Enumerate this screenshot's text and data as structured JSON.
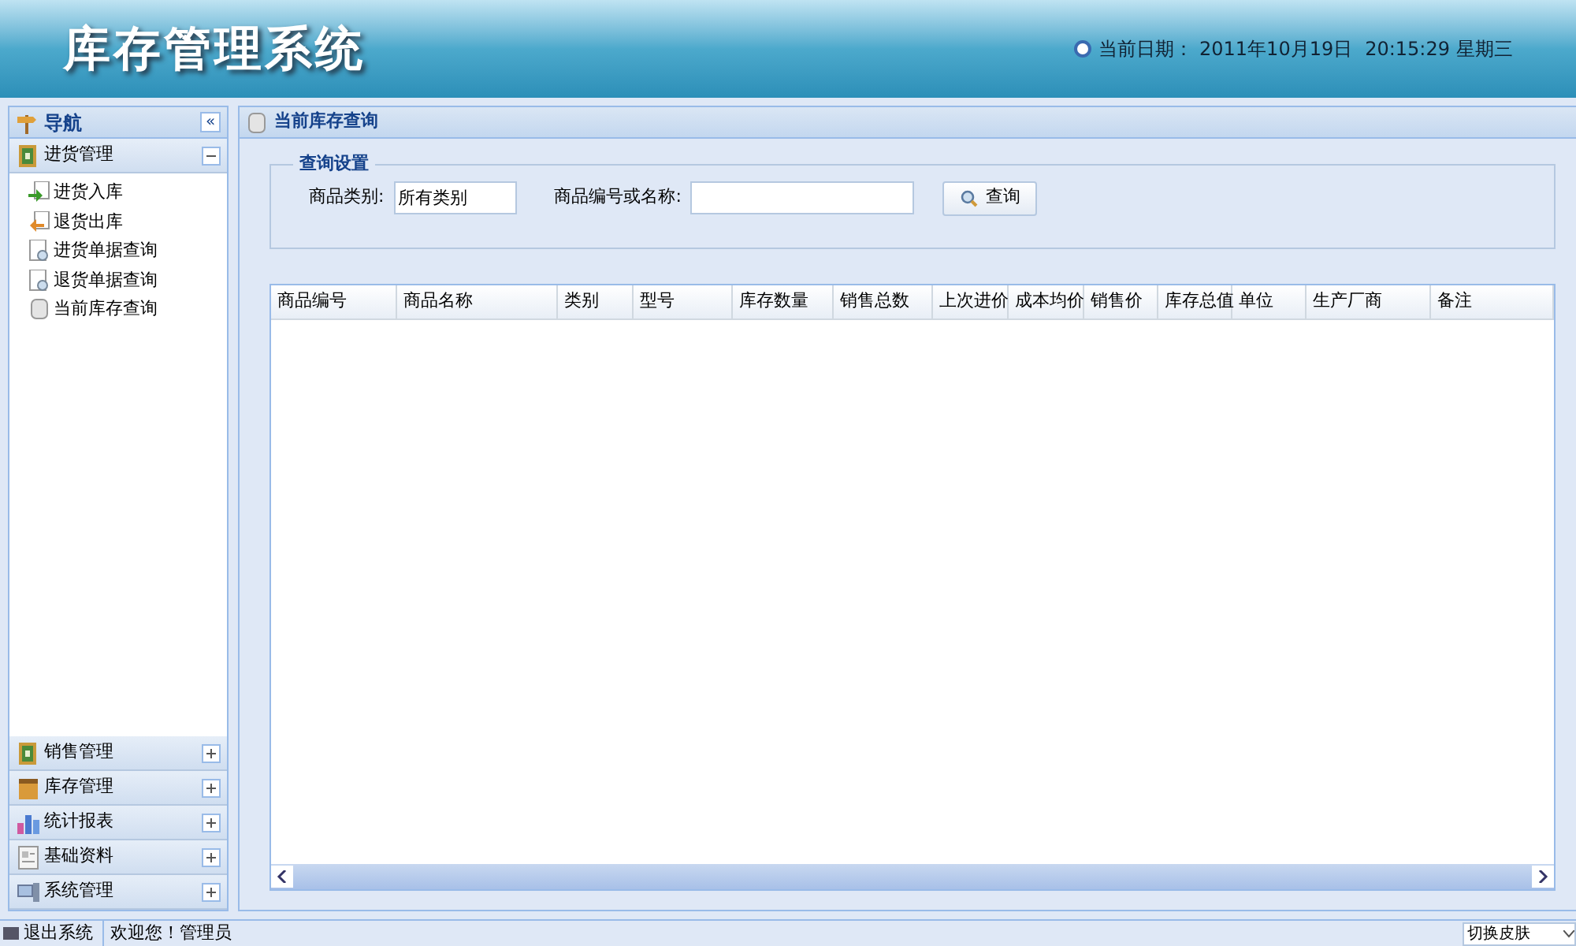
{
  "header": {
    "title": "库存管理系统",
    "date_label": "当前日期：",
    "date": "2011年10月19日",
    "time": "20:15:29",
    "weekday": "星期三"
  },
  "sidebar": {
    "title": "导航",
    "collapse_icon": "«",
    "groups": [
      {
        "label": "进货管理",
        "expanded": true,
        "kind": "purchase",
        "children": [
          {
            "label": "进货入库",
            "kind": "in"
          },
          {
            "label": "退货出库",
            "kind": "out"
          },
          {
            "label": "进货单据查询",
            "kind": "doc"
          },
          {
            "label": "退货单据查询",
            "kind": "doc"
          },
          {
            "label": "当前库存查询",
            "kind": "db"
          }
        ]
      },
      {
        "label": "销售管理",
        "expanded": false,
        "kind": "purchase"
      },
      {
        "label": "库存管理",
        "expanded": false,
        "kind": "box"
      },
      {
        "label": "统计报表",
        "expanded": false,
        "kind": "chart"
      },
      {
        "label": "基础资料",
        "expanded": false,
        "kind": "card"
      },
      {
        "label": "系统管理",
        "expanded": false,
        "kind": "pc"
      }
    ]
  },
  "main": {
    "title": "当前库存查询",
    "query": {
      "legend": "查询设置",
      "category_label": "商品类别:",
      "category_value": "所有类别",
      "keyword_label": "商品编号或名称:",
      "button": "查询"
    },
    "table": {
      "columns": [
        "商品编号",
        "商品名称",
        "类别",
        "型号",
        "库存数量",
        "销售总数",
        "上次进价",
        "成本均价",
        "销售价",
        "库存总值",
        "单位",
        "生产厂商",
        "备注"
      ]
    }
  },
  "status_bar": {
    "logout": "退出系统",
    "welcome": "欢迎您！管理员",
    "skin": "切换皮肤"
  }
}
